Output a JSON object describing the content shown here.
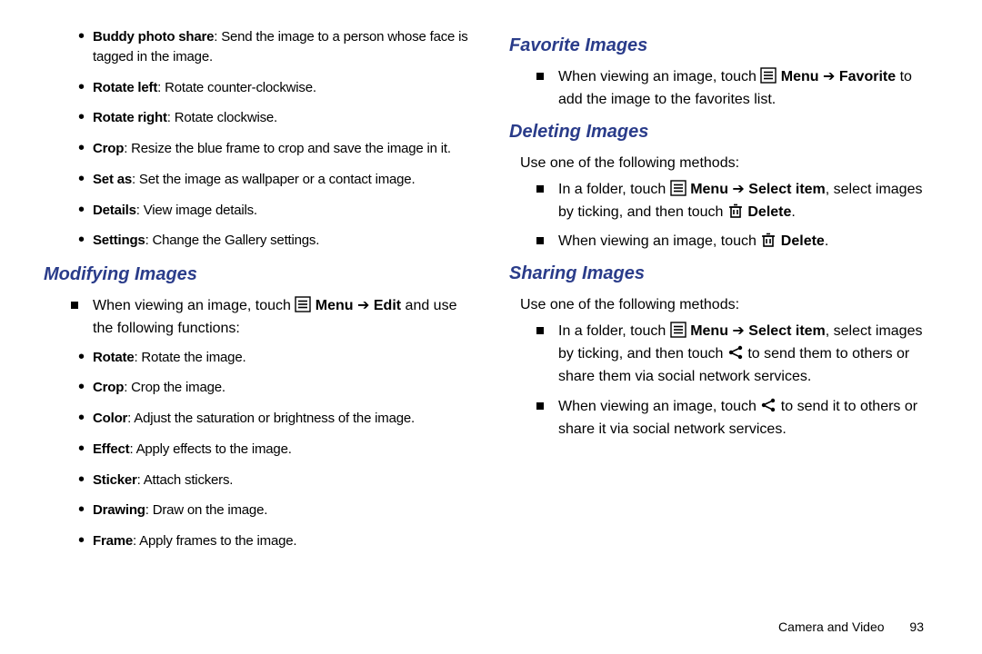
{
  "col1": {
    "top_list": [
      {
        "b": "Buddy photo share",
        "rest": ": Send the image to a person whose face is tagged in the image."
      },
      {
        "b": "Rotate left",
        "rest": ": Rotate counter-clockwise."
      },
      {
        "b": "Rotate right",
        "rest": ": Rotate clockwise."
      },
      {
        "b": "Crop",
        "rest": ": Resize the blue frame to crop and save the image in it."
      },
      {
        "b": "Set as",
        "rest": ": Set the image as wallpaper or a contact image."
      },
      {
        "b": "Details",
        "rest": ": View image details."
      },
      {
        "b": "Settings",
        "rest": ": Change the Gallery settings."
      }
    ],
    "modifying_heading": "Modifying Images",
    "modifying_intro_pre": "When viewing an image, touch ",
    "modifying_intro_menu": "Menu",
    "modifying_intro_arrow": " ➔ ",
    "modifying_intro_edit": "Edit",
    "modifying_intro_post": " and use the following functions:",
    "modify_list": [
      {
        "b": "Rotate",
        "rest": ": Rotate the image."
      },
      {
        "b": "Crop",
        "rest": ": Crop the image."
      },
      {
        "b": "Color",
        "rest": ": Adjust the saturation or brightness of the image."
      },
      {
        "b": "Effect",
        "rest": ": Apply effects to the image."
      },
      {
        "b": "Sticker",
        "rest": ": Attach stickers."
      },
      {
        "b": "Drawing",
        "rest": ": Draw on the image."
      },
      {
        "b": "Frame",
        "rest": ": Apply frames to the image."
      }
    ]
  },
  "col2": {
    "fav_heading": "Favorite Images",
    "fav_pre": "When viewing an image, touch ",
    "fav_menu": "Menu",
    "fav_arrow": " ➔ ",
    "fav_target": "Favorite",
    "fav_post": " to add the image to the favorites list.",
    "del_heading": "Deleting Images",
    "del_intro": "Use one of the following methods:",
    "del1_pre": "In a folder, touch ",
    "del1_menu": "Menu",
    "del1_arrow": " ➔ ",
    "del1_sel": "Select item",
    "del1_mid": ", select images by ticking, and then touch ",
    "del1_del": "Delete",
    "del1_post": ".",
    "del2_pre": "When viewing an image, touch ",
    "del2_del": "Delete",
    "del2_post": ".",
    "share_heading": "Sharing Images",
    "share_intro": "Use one of the following methods:",
    "share1_pre": "In a folder, touch ",
    "share1_menu": "Menu",
    "share1_arrow": " ➔ ",
    "share1_sel": "Select item",
    "share1_mid": ", select images by ticking, and then touch ",
    "share1_post": " to send them to others or share them via social network services.",
    "share2_pre": "When viewing an image, touch ",
    "share2_post": " to send it to others or share it via social network services."
  },
  "footer": {
    "section": "Camera and Video",
    "page": "93"
  }
}
